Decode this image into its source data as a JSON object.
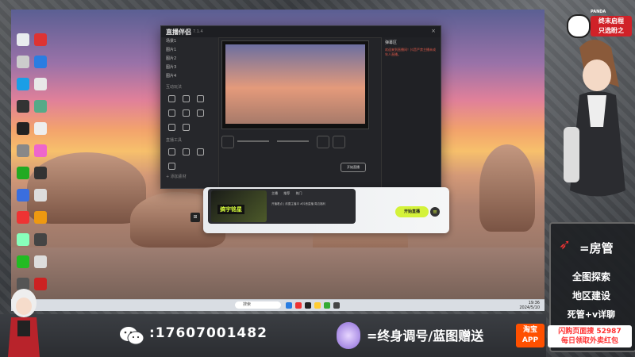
{
  "app": {
    "logo": "直播伴侣",
    "version": "7.1.4",
    "side_rows": [
      "场景1",
      "图片1",
      "图片2",
      "图片3",
      "图片4"
    ],
    "side_section_tools": "互动玩法",
    "side_section_plugins": "直播工具",
    "side_footer": "+ 添加素材",
    "right_tab": "弹幕区",
    "right_warning": "欢迎来到直播间！抖音严禁主播未成年人直播。",
    "go_live": "开始直播",
    "watermark": "直播伴侣 7.1.4"
  },
  "promo": {
    "tag": "搞宇铭星",
    "tabs": [
      "主播",
      "推荐",
      "热门"
    ],
    "text": "开播看点 | 前置主播冲 #抖音直播 周边福利",
    "start_button": "开始直播",
    "menu_icon": "≡",
    "grid_icon": "⊞"
  },
  "taskbar": {
    "search_placeholder": "搜索",
    "time": "19:36",
    "date": "2024/5/10"
  },
  "overlay": {
    "panda_name": "PANDA",
    "badge_line1": "终末启程",
    "badge_line2": "只选盼之",
    "fang": "=房管",
    "lines": [
      "全图探索",
      "地区建设",
      "死管+v详聊"
    ],
    "phone": ":17607001482",
    "slogan": "=终身调号/蓝图赠送",
    "taobao_line1": "淘宝",
    "taobao_line2": "APP",
    "tb_promo_line1": "闪购页面搜 52987",
    "tb_promo_line2": "每日领取外卖红包"
  },
  "colors": {
    "accent_green": "#d4f23a",
    "badge_red": "#d02128",
    "taobao_orange": "#ff5000"
  }
}
